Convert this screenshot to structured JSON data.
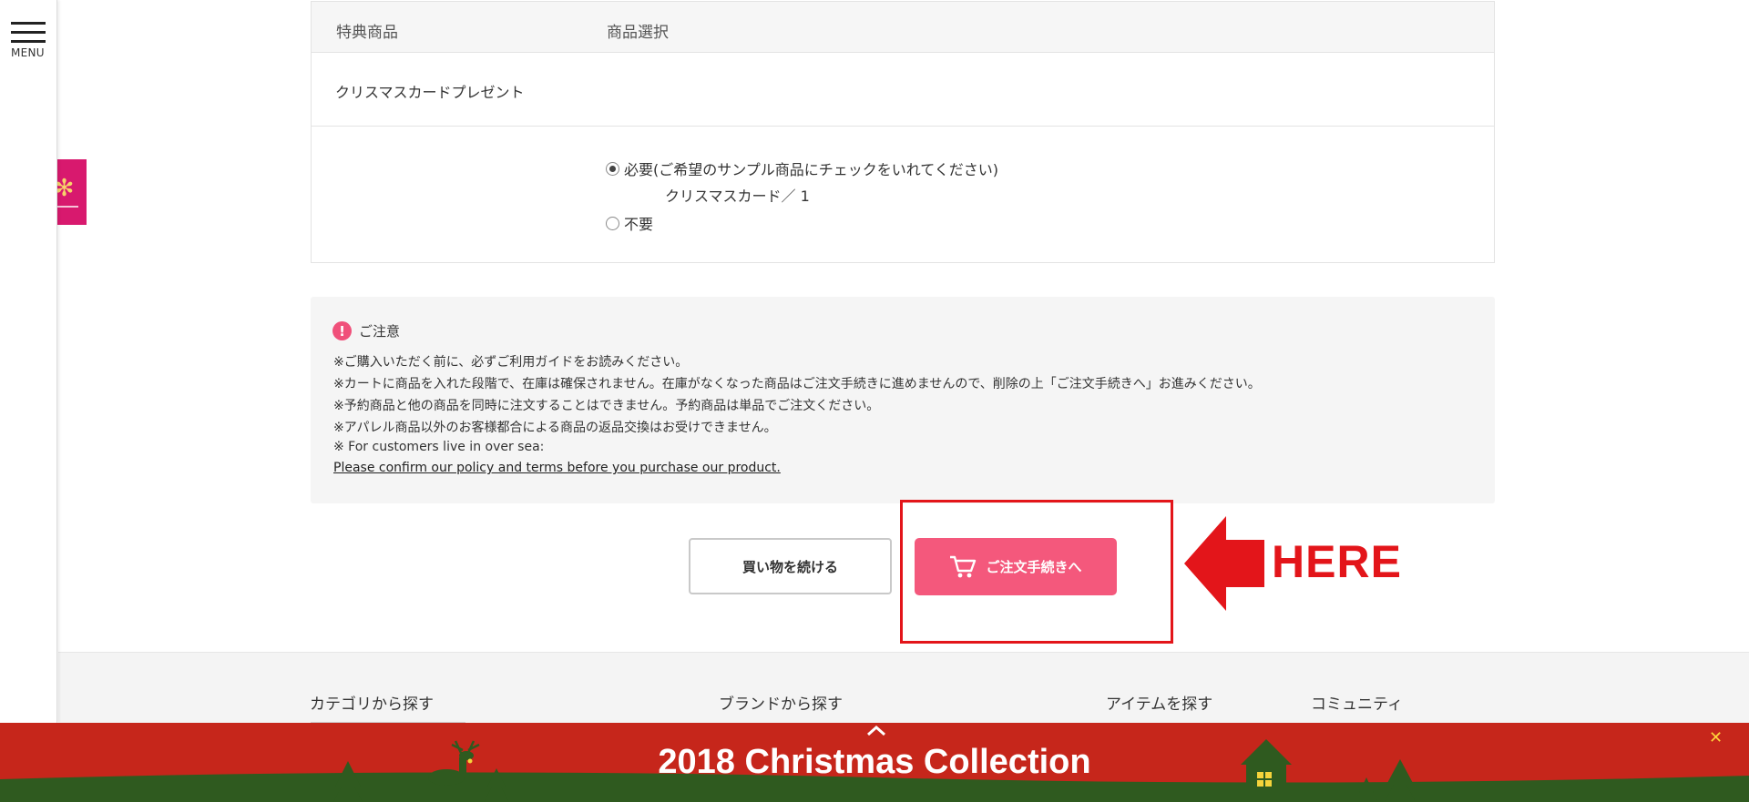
{
  "menu": {
    "label": "MENU"
  },
  "product_table": {
    "headers": [
      "特典商品",
      "商品選択"
    ],
    "item_title": "クリスマスカードプレゼント",
    "option_required": "必要(ご希望のサンプル商品にチェックをいれてください)",
    "option_required_detail": "クリスマスカード／ 1",
    "option_not_required": "不要",
    "selected": "必要"
  },
  "notice": {
    "title": "ご注意",
    "lines": [
      "※ご購入いただく前に、必ずご利用ガイドをお読みください。",
      "※カートに商品を入れた段階で、在庫は確保されません。在庫がなくなった商品はご注文手続きに進めませんので、削除の上「ご注文手続きへ」お進みください。",
      "※予約商品と他の商品を同時に注文することはできません。予約商品は単品でご注文ください。",
      "※アパレル商品以外のお客様都合による商品の返品交換はお受けできません。",
      "※ For customers live in over sea:"
    ],
    "link": "Please confirm our policy and terms before you purchase our product."
  },
  "buttons": {
    "continue_shopping": "買い物を続ける",
    "checkout": "ご注文手続きへ"
  },
  "annotation": {
    "here": "HERE",
    "color": "#e3151a"
  },
  "footer": {
    "headings": [
      "カテゴリから探す",
      "ブランドから探す",
      "アイテムを探す",
      "コミュニティ"
    ]
  },
  "banner": {
    "title": "2018 Christmas Collection",
    "bg": "#c6261b",
    "ground": "#2f5a1f"
  },
  "colors": {
    "accent": "#f4587c",
    "warning": "#f0507a"
  }
}
